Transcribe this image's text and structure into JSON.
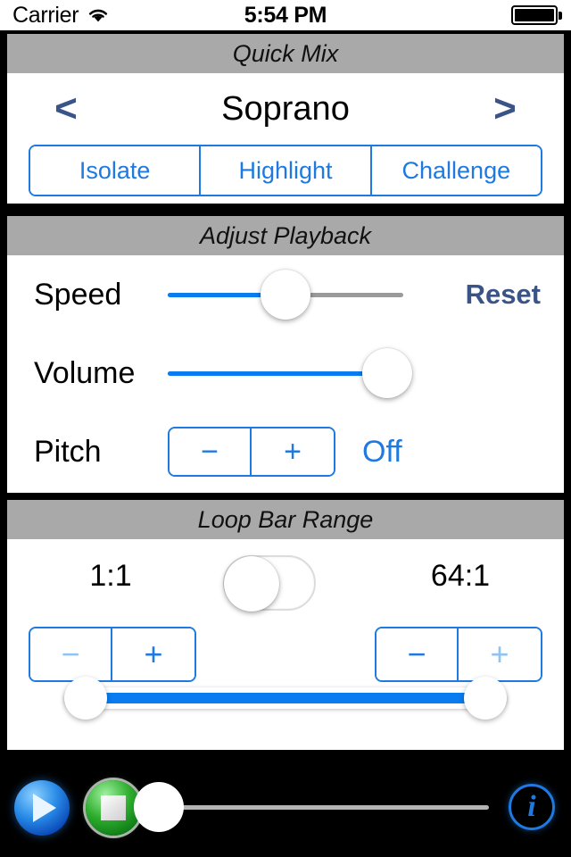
{
  "status_bar": {
    "carrier": "Carrier",
    "wifi_icon": "wifi-icon",
    "time": "5:54 PM",
    "battery_icon": "battery-full-icon"
  },
  "sections": {
    "quick_mix": {
      "header": "Quick Mix",
      "prev_label": "<",
      "next_label": ">",
      "current_part": "Soprano",
      "modes": [
        {
          "label": "Isolate"
        },
        {
          "label": "Highlight"
        },
        {
          "label": "Challenge"
        }
      ]
    },
    "adjust_playback": {
      "header": "Adjust Playback",
      "speed": {
        "label": "Speed",
        "value_percent": 50,
        "reset_label": "Reset"
      },
      "volume": {
        "label": "Volume",
        "value_percent": 93
      },
      "pitch": {
        "label": "Pitch",
        "minus_label": "−",
        "plus_label": "+",
        "state": "Off"
      }
    },
    "loop_bar_range": {
      "header": "Loop Bar Range",
      "start_value": "1:1",
      "end_value": "64:1",
      "toggle_state": "off",
      "start_stepper": {
        "minus_label": "−",
        "plus_label": "+",
        "minus_enabled": false,
        "plus_enabled": true
      },
      "end_stepper": {
        "minus_label": "−",
        "plus_label": "+",
        "minus_enabled": true,
        "plus_enabled": false
      },
      "range_slider": {
        "low_percent": 0,
        "high_percent": 100
      }
    }
  },
  "toolbar": {
    "play_icon": "play-icon",
    "stop_icon": "stop-icon",
    "scrub_percent": 0,
    "info_label": "i"
  },
  "colors": {
    "accent_blue": "#1e7ae0",
    "slider_blue": "#0a7cf0",
    "muted_navy": "#3b5488",
    "header_gray": "#a9a9a9",
    "disabled_blue": "#8fc3f2"
  }
}
